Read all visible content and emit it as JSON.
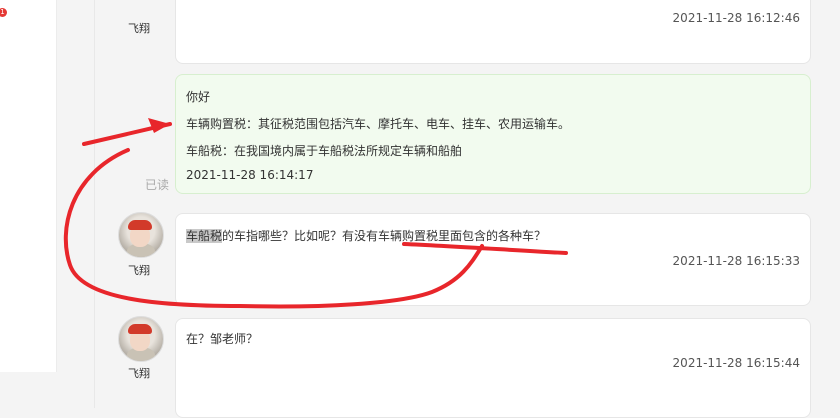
{
  "sidebar": {
    "badge": "1"
  },
  "messages": [
    {
      "sender": "飞翔",
      "text": "",
      "time": "2021-11-28 16:12:46"
    },
    {
      "sender": "",
      "lines": [
        "你好",
        "车辆购置税：其征税范围包括汽车、摩托车、电车、挂车、农用运输车。",
        "车船税：在我国境内属于车船税法所规定车辆和船舶"
      ],
      "time": "2021-11-28 16:14:17",
      "status": "已读"
    },
    {
      "sender": "飞翔",
      "text_hl": "车船税",
      "text": "的车指哪些？比如呢？有没有车辆购置税里面包含的各种车？",
      "time": "2021-11-28 16:15:33"
    },
    {
      "sender": "飞翔",
      "text": "在？邹老师？",
      "time": "2021-11-28 16:15:44"
    }
  ],
  "colors": {
    "annotation": "#e8262b",
    "own_bubble": "#f2fbef"
  }
}
